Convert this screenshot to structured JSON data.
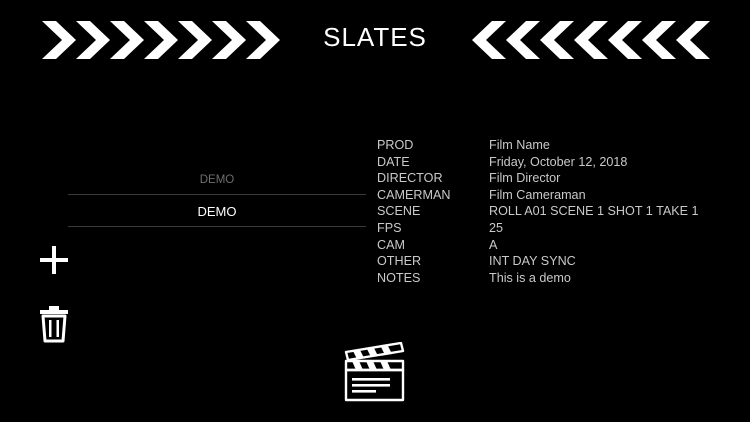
{
  "header": {
    "title": "SLATES"
  },
  "picker": {
    "items": [
      "DEMO",
      "DEMO"
    ]
  },
  "slate": {
    "rows": [
      {
        "label": "PROD",
        "value": "Film Name"
      },
      {
        "label": "DATE",
        "value": "Friday, October 12, 2018"
      },
      {
        "label": "DIRECTOR",
        "value": "Film Director"
      },
      {
        "label": "CAMERMAN",
        "value": "Film Cameraman"
      },
      {
        "label": "SCENE",
        "value": "ROLL A01 SCENE 1 SHOT 1 TAKE 1"
      },
      {
        "label": "FPS",
        "value": "25"
      },
      {
        "label": "CAM",
        "value": "A"
      },
      {
        "label": "OTHER",
        "value": "INT DAY SYNC"
      },
      {
        "label": "NOTES",
        "value": "This is a demo"
      }
    ]
  },
  "icons": {
    "add": "plus-icon",
    "delete": "trash-icon",
    "slate": "clapperboard-icon",
    "decor_left": "chevrons-right-icon",
    "decor_right": "chevrons-left-icon"
  },
  "colors": {
    "background": "#000000",
    "text": "#ffffff",
    "secondary_text": "#c9c9c9",
    "dim_text": "#6e6e6e",
    "divider": "#3a3a3a"
  }
}
